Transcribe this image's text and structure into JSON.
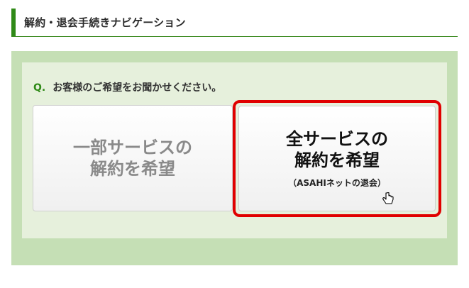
{
  "header": {
    "title": "解約・退会手続きナビゲーション"
  },
  "question": {
    "prefix": "Q.",
    "text": "お客様のご希望をお聞かせください。"
  },
  "options": [
    {
      "line1": "一部サービスの",
      "line2": "解約を希望"
    },
    {
      "line1": "全サービスの",
      "line2": "解約を希望",
      "sub": "（ASAHIネットの退会）"
    }
  ],
  "colors": {
    "accent": "#2f8a17",
    "highlight_border": "#e00000",
    "panel_bg": "#c5dfb5"
  },
  "icons": {
    "cursor": "hand-pointer-icon"
  }
}
